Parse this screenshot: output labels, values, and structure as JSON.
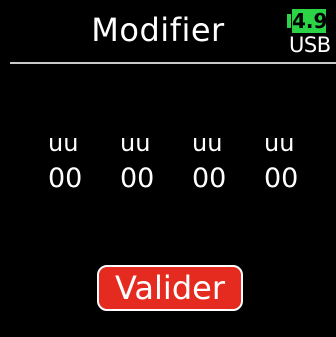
{
  "header": {
    "title": "Modifier"
  },
  "battery": {
    "value": "4.9",
    "source": "USB",
    "accent_color": "#2bd447"
  },
  "fields": [
    {
      "upper": "uu",
      "lower": "00"
    },
    {
      "upper": "uu",
      "lower": "00"
    },
    {
      "upper": "uu",
      "lower": "00"
    },
    {
      "upper": "uu",
      "lower": "00"
    }
  ],
  "actions": {
    "confirm_label": "Valider",
    "confirm_color": "#e52b1f"
  }
}
